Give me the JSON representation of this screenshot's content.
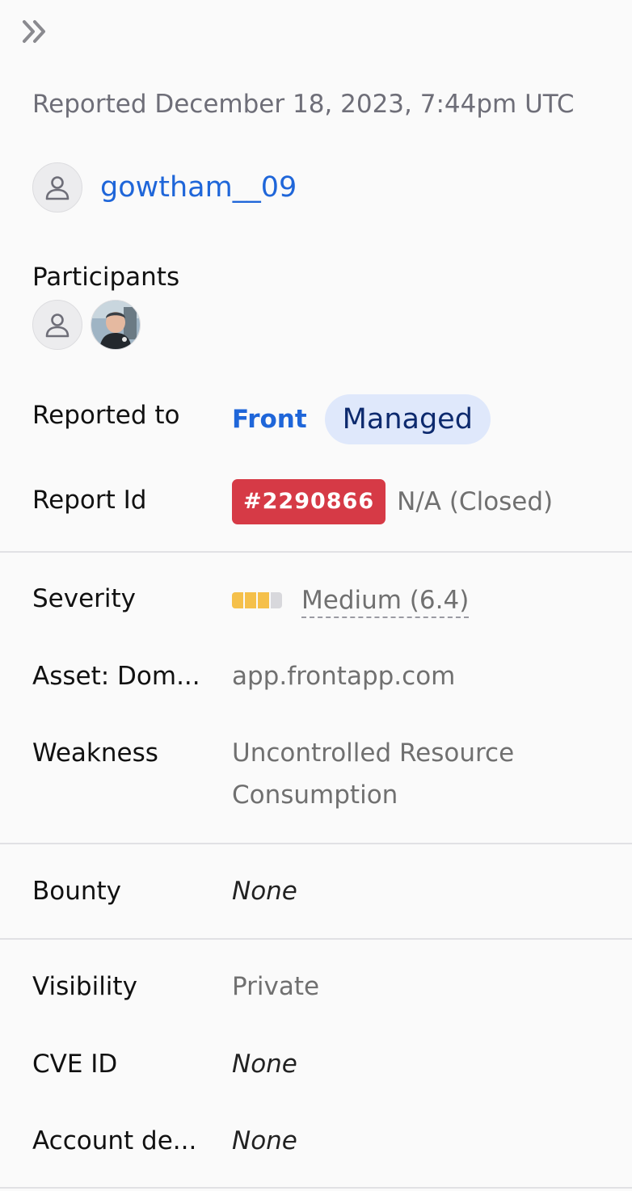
{
  "header": {
    "collapse_icon": "double-chevron-right-icon",
    "reported_date": "Reported December 18, 2023, 7:44pm UTC"
  },
  "reporter": {
    "avatar_icon": "user-icon",
    "username": "gowtham__09"
  },
  "participants": {
    "label": "Participants"
  },
  "report": {
    "reported_to_label": "Reported to",
    "program_name": "Front",
    "program_badge": "Managed",
    "report_id_label": "Report Id",
    "report_id": "#2290866",
    "report_status": "N/A (Closed)"
  },
  "details": {
    "severity_label": "Severity",
    "severity_value": "Medium (6.4)",
    "severity_level": 6.4,
    "asset_label": "Asset: Dom...",
    "asset_value": "app.frontapp.com",
    "weakness_label": "Weakness",
    "weakness_line1": "Uncontrolled Resource",
    "weakness_line2": "Consumption"
  },
  "bounty": {
    "label": "Bounty",
    "value": "None"
  },
  "meta": {
    "visibility_label": "Visibility",
    "visibility_value": "Private",
    "cve_label": "CVE ID",
    "cve_value": "None",
    "account_label": "Account de...",
    "account_value": "None"
  },
  "colors": {
    "link": "#1f66d9",
    "badge_red": "#d63a46",
    "severity_filled": "#f5c04a",
    "severity_empty": "#d8d8dc",
    "pill_bg": "#dfe8fb"
  }
}
